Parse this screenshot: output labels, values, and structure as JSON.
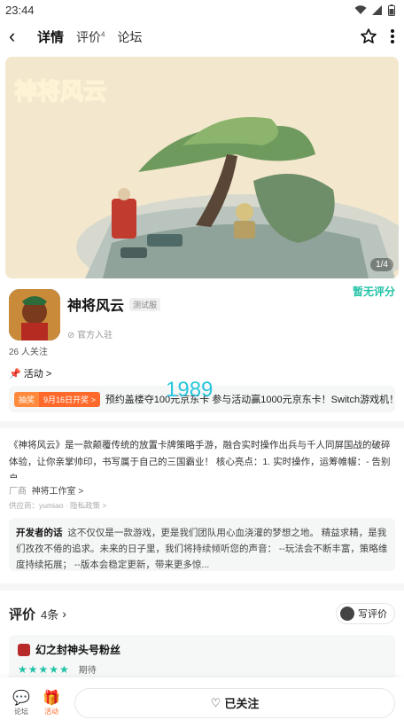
{
  "status_bar": {
    "time": "23:44"
  },
  "nav": {
    "tabs": [
      {
        "label": "详情"
      },
      {
        "label": "评价",
        "count": "4"
      },
      {
        "label": "论坛"
      }
    ]
  },
  "hero": {
    "logo_text": "神将风云",
    "counter": "1/4"
  },
  "app": {
    "name": "神将风云",
    "test_tag": "测试服",
    "official": "官方入驻",
    "no_score": "暂无评分",
    "followers": "26 人关注"
  },
  "activity": {
    "title": "活动 >",
    "badge_prize": "抽奖",
    "badge_date": "9月16日开奖 >",
    "text": "预约盖楼夺100元京东卡 参与活动赢1000元京东卡！Switch游戏机！"
  },
  "overlay_number": "1989",
  "description": "《神将风云》是一款颠覆传统的放置卡牌策略手游，融合实时操作出兵与千人同屏国战的破碎体验，让你亲掌帅印，书写属于自己的三国霸业！ 核心亮点：1. 实时操作，运筹帷幄：- 告别自...",
  "vendor": {
    "label": "厂商",
    "value": "神将工作室 >"
  },
  "provider": {
    "text": "供应商：yumiao · 隐私政策 >"
  },
  "developer_note": {
    "label": "开发者的话",
    "text": "这不仅仅是一款游戏，更是我们团队用心血浇灌的梦想之地。 精益求精，是我们孜孜不倦的追求。未来的日子里，我们将持续倾听您的声音： --玩法会不断丰富，策略维度持续拓展； --版本会稳定更新，带来更多惊..."
  },
  "reviews": {
    "title": "评价",
    "count": "4条",
    "write_label": "写评价",
    "items": [
      {
        "user": "幻之封神头号粉丝",
        "stars": "★★★★★",
        "tag": "期待"
      }
    ]
  },
  "bottom_bar": {
    "forum_label": "论坛",
    "activity_label": "活动",
    "follow_label": "已关注"
  },
  "colors": {
    "accent": "#21c2a6",
    "orange": "#ff6a2c"
  }
}
